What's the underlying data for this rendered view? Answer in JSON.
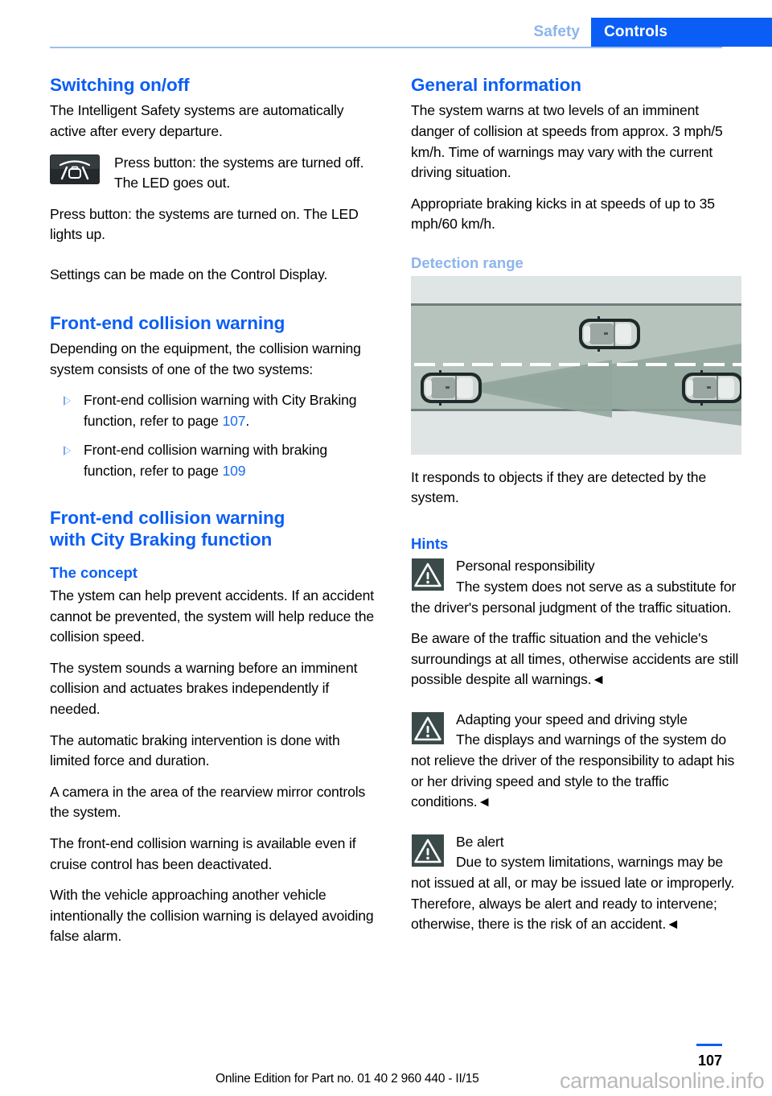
{
  "header": {
    "tab_inactive": "Safety",
    "tab_active": "Controls"
  },
  "colors": {
    "accent_blue": "#0b5ef5",
    "faded_blue": "#8cb4ee",
    "xref_blue": "#1f6bf0",
    "warning_icon_bg": "#3a4a49",
    "road_surface": "#b5c3bd",
    "road_shoulder": "#dde2e3",
    "detection_cone": "#8ea39a",
    "watermark_gray": "#b9b9b9"
  },
  "left_column": {
    "switching_heading": "Switching on/off",
    "switching_p1": "The Intelligent Safety systems are automatically active after every departure.",
    "button_icon_name": "intelligent-safety-button-icon",
    "button_icon_text": "Press button: the systems are turned off. The LED goes out.",
    "switching_p2": "Press button: the systems are turned on. The LED lights up.",
    "switching_p3": "Settings can be made on the Control Display.",
    "fcw_heading": "Front-end collision warning",
    "fcw_intro": "Depending on the equipment, the collision warning system consists of one of the two systems:",
    "fcw_bullets": [
      {
        "text": "Front-end collision warning with City Braking function, refer to page ",
        "page": "107",
        "suffix": "."
      },
      {
        "text": "Front-end collision warning with braking function, refer to page ",
        "page": "109",
        "suffix": ""
      }
    ],
    "fcw_city_heading_line1": "Front-end collision warning",
    "fcw_city_heading_line2": "with City Braking function",
    "concept_heading": "The concept",
    "concept_p1": "The ystem can help prevent accidents. If an accident cannot be prevented, the system will help reduce the collision speed.",
    "concept_p2": "The system sounds a warning before an imminent collision and actuates brakes independently if needed.",
    "concept_p3": "The automatic braking intervention is done with limited force and duration.",
    "concept_p4": "A camera in the area of the rearview mirror controls the system.",
    "concept_p5": "The front-end collision warning is available even if cruise control has been deactivated.",
    "concept_p6": "With the vehicle approaching another vehicle intentionally the collision warning is delayed avoiding false alarm."
  },
  "right_column": {
    "general_heading": "General information",
    "general_p1": "The system warns at two levels of an imminent danger of collision at speeds from approx. 3 mph/5 km/h. Time of warnings may vary with the current driving situation.",
    "general_p2": "Appropriate braking kicks in at speeds of up to 35 mph/60 km/h.",
    "detection_heading": "Detection range",
    "figure_name": "detection-range-illustration",
    "figure_caption": "It responds to objects if they are detected by the system.",
    "hints_heading": "Hints",
    "warnings": [
      {
        "title": "Personal responsibility",
        "body": "The system does not serve as a substitute for the driver's personal judgment of the traffic situation.",
        "body2": "Be aware of the traffic situation and the vehicle's surroundings at all times, otherwise accidents are still possible despite all warnings.◄"
      },
      {
        "title": "Adapting your speed and driving style",
        "body": "The displays and warnings of the system do not relieve the driver of the responsibility to adapt his or her driving speed and style to the traffic conditions.◄",
        "body2": ""
      },
      {
        "title": "Be alert",
        "body": "Due to system limitations, warnings may be not issued at all, or may be issued late or improperly. Therefore, always be alert and ready to intervene; otherwise, there is the risk of an accident.◄",
        "body2": ""
      }
    ]
  },
  "footer": {
    "page_number": "107",
    "edition_text": "Online Edition for Part no. 01 40 2 960 440 - II/15",
    "watermark": "carmanualsonline.info"
  }
}
